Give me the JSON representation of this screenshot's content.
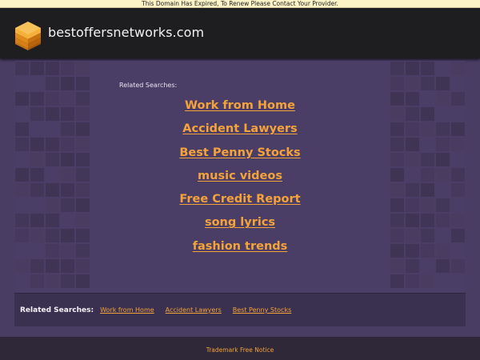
{
  "notice": {
    "text": "This Domain Has Expired, To Renew Please Contact Your Provider."
  },
  "header": {
    "site_name": "bestoffersnetworks.com",
    "logo_icon": "stacked-layers-icon",
    "logo_colors": [
      "#f5a623",
      "#e8891a",
      "#cf6f12"
    ]
  },
  "main": {
    "related_label": "Related Searches:",
    "links": [
      {
        "label": "Work from Home"
      },
      {
        "label": "Accident Lawyers"
      },
      {
        "label": "Best Penny Stocks"
      },
      {
        "label": "music videos"
      },
      {
        "label": "Free Credit Report"
      },
      {
        "label": "song lyrics"
      },
      {
        "label": "fashion trends"
      }
    ]
  },
  "footer_related": {
    "title": "Related Searches:",
    "links": [
      {
        "label": "Work from Home"
      },
      {
        "label": "Accident Lawyers"
      },
      {
        "label": "Best Penny Stocks"
      }
    ]
  },
  "bottom": {
    "notice_link": "Trademark Free Notice"
  },
  "colors": {
    "accent": "#f4a23a",
    "page_bg": "#4a3d63",
    "header_bg": "#1e1d1f",
    "notice_bg": "#fcf3c6"
  }
}
